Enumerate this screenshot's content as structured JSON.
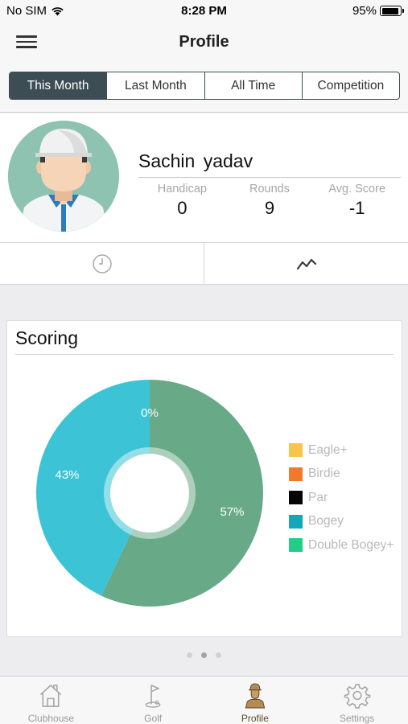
{
  "status_bar": {
    "carrier": "No SIM",
    "time": "8:28 PM",
    "battery": "95%",
    "battery_level": 0.95
  },
  "nav": {
    "title": "Profile",
    "menu_icon": "hamburger-menu-icon"
  },
  "segments": [
    {
      "label": "This Month",
      "active": true
    },
    {
      "label": "Last Month",
      "active": false
    },
    {
      "label": "All Time",
      "active": false
    },
    {
      "label": "Competition",
      "active": false
    }
  ],
  "profile": {
    "name": "Sachin  yadav",
    "stats": [
      {
        "label": "Handicap",
        "value": "0"
      },
      {
        "label": "Rounds",
        "value": "9"
      },
      {
        "label": "Avg. Score",
        "value": "-1"
      }
    ]
  },
  "view_toggle": {
    "left_icon": "clock-icon",
    "right_icon": "trend-line-icon"
  },
  "scoring": {
    "title": "Scoring",
    "legend": [
      {
        "label": "Eagle+",
        "color": "#f9c44a"
      },
      {
        "label": "Birdie",
        "color": "#f07a2c"
      },
      {
        "label": "Par",
        "color": "#050505"
      },
      {
        "label": "Bogey",
        "color": "#12a7bd"
      },
      {
        "label": "Double Bogey+",
        "color": "#1fcf85"
      }
    ]
  },
  "chart_data": {
    "type": "pie",
    "title": "Scoring",
    "donut": true,
    "slices": [
      {
        "label": "Eagle+",
        "value": 0,
        "display": "0%",
        "color": "#f9c44a"
      },
      {
        "label": "Birdie",
        "value": 0,
        "display": "",
        "color": "#f07a2c"
      },
      {
        "label": "Par",
        "value": 57,
        "display": "57%",
        "color": "#68a987"
      },
      {
        "label": "Bogey",
        "value": 43,
        "display": "43%",
        "color": "#3cc4d6"
      },
      {
        "label": "Double Bogey+",
        "value": 0,
        "display": "",
        "color": "#1fcf85"
      }
    ]
  },
  "pager": {
    "count": 3,
    "active_index": 1
  },
  "tabs": [
    {
      "label": "Clubhouse",
      "icon": "clubhouse-icon",
      "active": false
    },
    {
      "label": "Golf",
      "icon": "golf-flag-icon",
      "active": false
    },
    {
      "label": "Profile",
      "icon": "golfer-profile-icon",
      "active": true
    },
    {
      "label": "Settings",
      "icon": "gear-icon",
      "active": false
    }
  ]
}
